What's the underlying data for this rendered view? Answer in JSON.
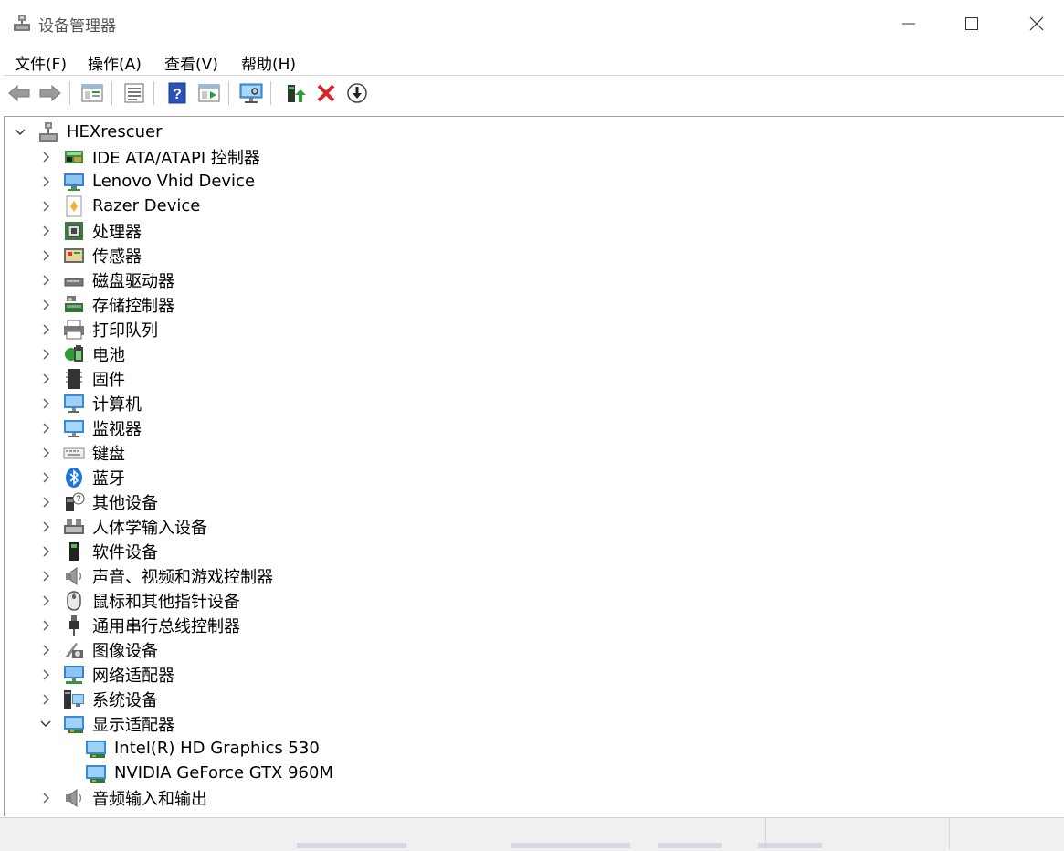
{
  "window": {
    "title": "设备管理器",
    "icon": "device-manager-icon",
    "controls": [
      "minimize-icon",
      "maximize-icon",
      "close-icon"
    ]
  },
  "menu": {
    "file": "文件(F)",
    "action": "操作(A)",
    "view": "查看(V)",
    "help": "帮助(H)"
  },
  "toolbar": {
    "buttons": [
      "back-icon",
      "forward-icon",
      "show-hide-tree-icon",
      "properties-icon",
      "help-icon",
      "details-view-icon",
      "scan-hardware-icon",
      "update-driver-icon",
      "uninstall-icon",
      "disable-device-icon"
    ]
  },
  "tree": {
    "root": "HEXrescuer",
    "categories": [
      {
        "label": "IDE ATA/ATAPI 控制器",
        "icon": "ide-controller-icon",
        "expanded": false
      },
      {
        "label": "Lenovo Vhid Device",
        "icon": "network-monitor-icon",
        "expanded": false
      },
      {
        "label": "Razer Device",
        "icon": "razer-device-icon",
        "expanded": false
      },
      {
        "label": "处理器",
        "icon": "processor-icon",
        "expanded": false
      },
      {
        "label": "传感器",
        "icon": "sensor-icon",
        "expanded": false
      },
      {
        "label": "磁盘驱动器",
        "icon": "disk-drive-icon",
        "expanded": false
      },
      {
        "label": "存储控制器",
        "icon": "storage-controller-icon",
        "expanded": false
      },
      {
        "label": "打印队列",
        "icon": "printer-icon",
        "expanded": false
      },
      {
        "label": "电池",
        "icon": "battery-icon",
        "expanded": false
      },
      {
        "label": "固件",
        "icon": "firmware-icon",
        "expanded": false
      },
      {
        "label": "计算机",
        "icon": "computer-icon",
        "expanded": false
      },
      {
        "label": "监视器",
        "icon": "monitor-icon",
        "expanded": false
      },
      {
        "label": "键盘",
        "icon": "keyboard-icon",
        "expanded": false
      },
      {
        "label": "蓝牙",
        "icon": "bluetooth-icon",
        "expanded": false
      },
      {
        "label": "其他设备",
        "icon": "unknown-device-icon",
        "expanded": false
      },
      {
        "label": "人体学输入设备",
        "icon": "hid-icon",
        "expanded": false
      },
      {
        "label": "软件设备",
        "icon": "software-device-icon",
        "expanded": false
      },
      {
        "label": "声音、视频和游戏控制器",
        "icon": "speaker-icon",
        "expanded": false
      },
      {
        "label": "鼠标和其他指针设备",
        "icon": "mouse-icon",
        "expanded": false
      },
      {
        "label": "通用串行总线控制器",
        "icon": "usb-icon",
        "expanded": false
      },
      {
        "label": "图像设备",
        "icon": "camera-icon",
        "expanded": false
      },
      {
        "label": "网络适配器",
        "icon": "network-adapter-icon",
        "expanded": false
      },
      {
        "label": "系统设备",
        "icon": "system-device-icon",
        "expanded": false
      },
      {
        "label": "显示适配器",
        "icon": "display-adapter-icon",
        "expanded": true,
        "children": [
          {
            "label": "Intel(R) HD Graphics 530",
            "icon": "display-adapter-icon"
          },
          {
            "label": "NVIDIA GeForce GTX 960M",
            "icon": "display-adapter-icon"
          }
        ]
      },
      {
        "label": "音频输入和输出",
        "icon": "speaker-icon",
        "expanded": false
      }
    ]
  },
  "colors": {
    "accent_blue": "#1e73d6",
    "uninstall_red": "#d8252a",
    "green": "#2e9a3a"
  }
}
